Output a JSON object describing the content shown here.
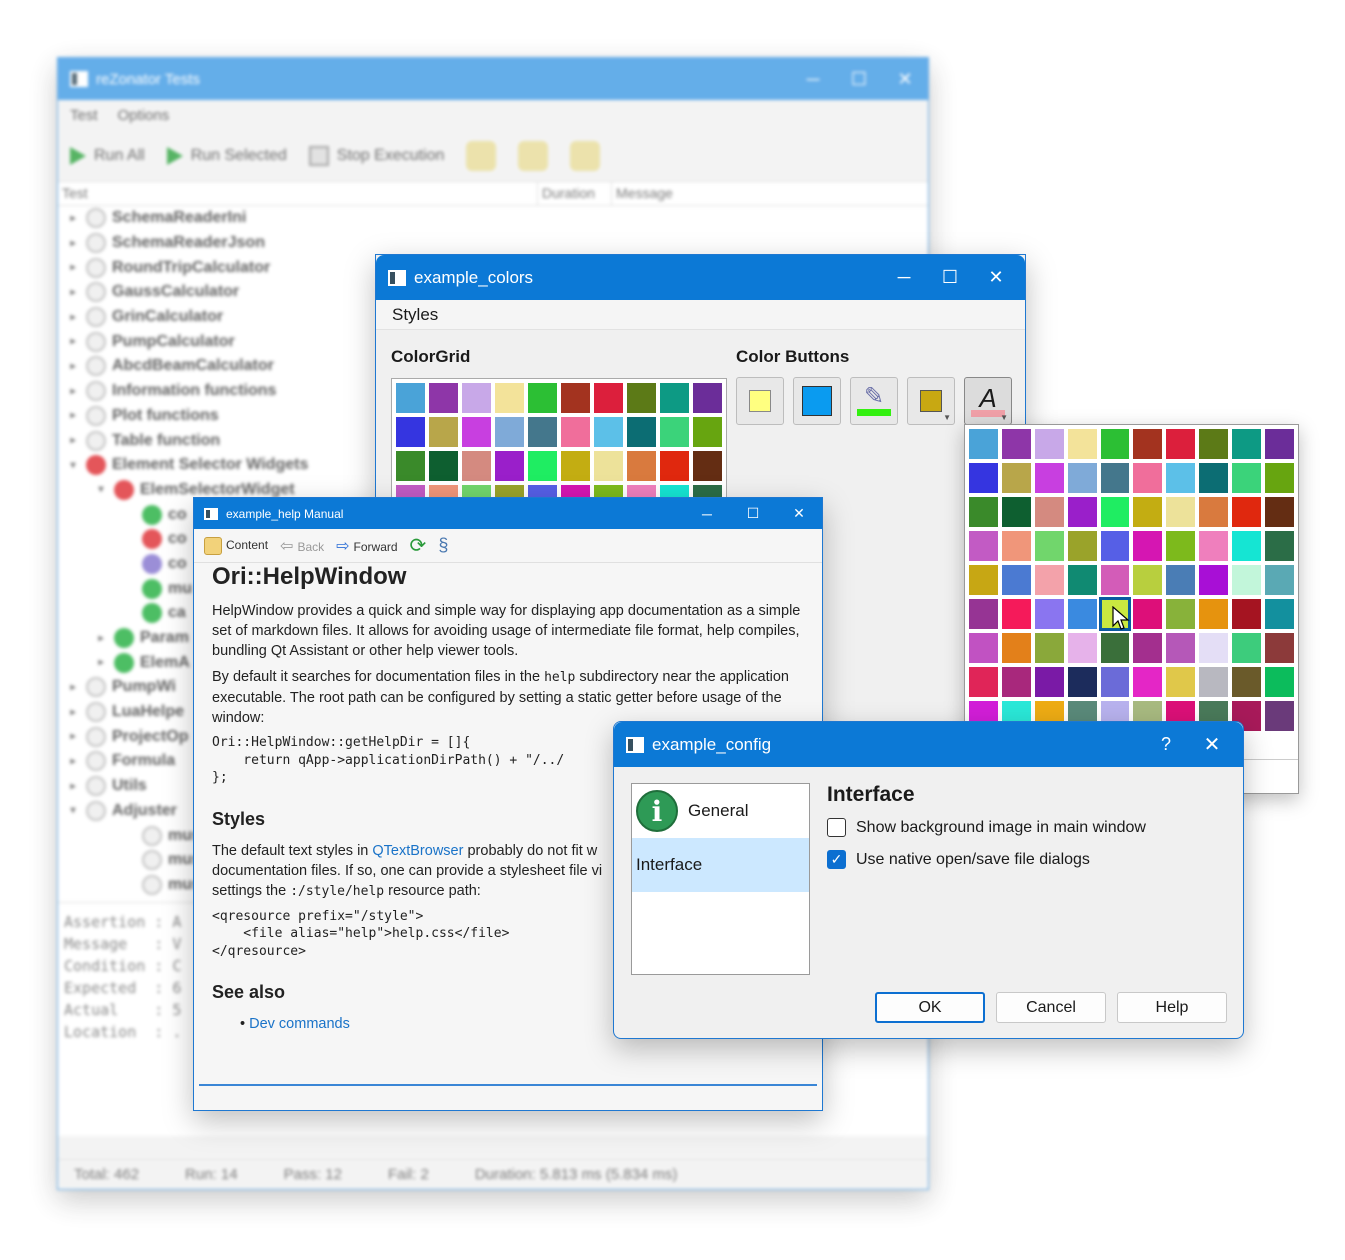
{
  "bg_window": {
    "title": "reZonator Tests",
    "menu": [
      "Test",
      "Options"
    ],
    "toolbar": {
      "run_all": "Run All",
      "run_selected": "Run Selected",
      "stop": "Stop Execution"
    },
    "columns": [
      "Test",
      "Duration",
      "Message"
    ],
    "tree": [
      {
        "label": "SchemaReaderIni",
        "status": "none",
        "level": 0,
        "arrow": "▸"
      },
      {
        "label": "SchemaReaderJson",
        "status": "none",
        "level": 0,
        "arrow": "▸"
      },
      {
        "label": "RoundTripCalculator",
        "status": "none",
        "level": 0,
        "arrow": "▸"
      },
      {
        "label": "GaussCalculator",
        "status": "none",
        "level": 0,
        "arrow": "▸"
      },
      {
        "label": "GrinCalculator",
        "status": "none",
        "level": 0,
        "arrow": "▸"
      },
      {
        "label": "PumpCalculator",
        "status": "none",
        "level": 0,
        "arrow": "▸"
      },
      {
        "label": "AbcdBeamCalculator",
        "status": "none",
        "level": 0,
        "arrow": "▸"
      },
      {
        "label": "Information functions",
        "status": "none",
        "level": 0,
        "arrow": "▸"
      },
      {
        "label": "Plot functions",
        "status": "none",
        "level": 0,
        "arrow": "▸"
      },
      {
        "label": "Table function",
        "status": "none",
        "level": 0,
        "arrow": "▸"
      },
      {
        "label": "Element Selector Widgets",
        "status": "fail",
        "level": 0,
        "arrow": "▾"
      },
      {
        "label": "ElemSelectorWidget",
        "status": "fail",
        "level": 1,
        "arrow": "▾"
      },
      {
        "label": "co",
        "status": "pass",
        "level": 2,
        "arrow": ""
      },
      {
        "label": "co",
        "status": "fail",
        "level": 2,
        "arrow": ""
      },
      {
        "label": "co",
        "status": "skip",
        "level": 2,
        "arrow": ""
      },
      {
        "label": "mu",
        "status": "pass",
        "level": 2,
        "arrow": ""
      },
      {
        "label": "ca",
        "status": "pass",
        "level": 2,
        "arrow": ""
      },
      {
        "label": "Param",
        "status": "pass",
        "level": 1,
        "arrow": "▸"
      },
      {
        "label": "ElemA",
        "status": "pass",
        "level": 1,
        "arrow": "▸"
      },
      {
        "label": "PumpWi",
        "status": "none",
        "level": 0,
        "arrow": "▸"
      },
      {
        "label": "LuaHelpe",
        "status": "none",
        "level": 0,
        "arrow": "▸"
      },
      {
        "label": "ProjectOp",
        "status": "none",
        "level": 0,
        "arrow": "▸"
      },
      {
        "label": "Formula",
        "status": "none",
        "level": 0,
        "arrow": "▸"
      },
      {
        "label": "Utils",
        "status": "none",
        "level": 0,
        "arrow": "▸"
      },
      {
        "label": "Adjuster",
        "status": "none",
        "level": 0,
        "arrow": "▾"
      },
      {
        "label": "must_",
        "status": "none",
        "level": 2,
        "arrow": ""
      },
      {
        "label": "must_",
        "status": "none",
        "level": 2,
        "arrow": ""
      },
      {
        "label": "must_",
        "status": "none",
        "level": 2,
        "arrow": ""
      }
    ],
    "details": [
      "Assertion : A",
      "Message   : V",
      "Condition : C",
      "Expected  : 6",
      "Actual    : 5",
      "Location  : ."
    ],
    "status": {
      "total": "Total: 462",
      "run": "Run: 14",
      "pass": "Pass: 12",
      "fail": "Fail: 2",
      "duration": "Duration: 5.813 ms (5.834 ms)"
    }
  },
  "colors_window": {
    "title": "example_colors",
    "menu": "Styles",
    "grid_title": "ColorGrid",
    "buttons_title": "Color Buttons"
  },
  "palette": [
    "#4aa3d8",
    "#8e36a8",
    "#c8a8e8",
    "#f3e39a",
    "#2cbf34",
    "#a3331f",
    "#dc1f3c",
    "#5c7a17",
    "#0d9a84",
    "#6b2d99",
    "#3535e0",
    "#b8a64a",
    "#c83fe0",
    "#7faad8",
    "#44778c",
    "#f06e9b",
    "#5cc0e8",
    "#0c6d73",
    "#3bd37a",
    "#67a510",
    "#3a8a2a",
    "#0e5f30",
    "#d48a80",
    "#9a1fca",
    "#1fed62",
    "#c3ad12",
    "#ede29a",
    "#d97a3e",
    "#e0280e",
    "#642d13",
    "#c25bc4",
    "#f0967a",
    "#71d66c",
    "#9aa32a",
    "#565fe6",
    "#d516b2",
    "#7dba1c",
    "#ef7fbd",
    "#15e5d3",
    "#2b6d47",
    "#c7a714",
    "#4b7ad2",
    "#f3a2aa",
    "#108a72",
    "#d35cb8",
    "#b8cf3e",
    "#4a7db5",
    "#a80fd6",
    "#c2f6da",
    "#5aa9b4",
    "#963494",
    "#f51a5a",
    "#8a75f0",
    "#3a8ae0",
    "#c9e840",
    "#dd0f79",
    "#88b23a",
    "#e6930e",
    "#a51421",
    "#13909e",
    "#c152c2",
    "#e3801a",
    "#8aa83a",
    "#e6b2ea",
    "#3a6f3a",
    "#a32f8e",
    "#b558b8",
    "#e4def6",
    "#3dcc7c",
    "#8c3a3a",
    "#e02558",
    "#a8287c",
    "#7a1aa6",
    "#1c2c5c",
    "#6b6bd8",
    "#e426c6",
    "#e0c84a",
    "#b8b8c0",
    "#6a5a2a",
    "#0cbc5c",
    "#d21ed8",
    "#2ae8d8",
    "#eeac14",
    "#5a8a7a",
    "#b8b2ee",
    "#a8ba80",
    "#dc1078",
    "#4a7a5a",
    "#a81a5a",
    "#6a3a7a"
  ],
  "help_window": {
    "title": "example_help Manual",
    "toolbar": {
      "content": "Content",
      "back": "Back",
      "forward": "Forward"
    },
    "heading": "Ori::HelpWindow",
    "p1": "HelpWindow provides a quick and simple way for displaying app documentation as a simple set of markdown files. It allows for avoiding usage of intermediate file format, help compiles, bundling Qt Assistant or other help viewer tools.",
    "p2_a": "By default it searches for documentation files in the ",
    "p2_code": "help",
    "p2_b": " subdirectory near the application executable. The root path can be configured by setting a static getter before usage of the window:",
    "code1": "Ori::HelpWindow::getHelpDir = []{\n    return qApp->applicationDirPath() + \"/../\n};",
    "h_styles": "Styles",
    "p3_a": "The default text styles in ",
    "p3_link": "QTextBrowser",
    "p3_b": " probably do not fit w",
    "p3_c": "documentation files. If so, one can provide a stylesheet file vi",
    "p3_d": "settings the ",
    "p3_code": ":/style/help",
    "p3_e": " resource path:",
    "code2": "<qresource prefix=\"/style\">\n    <file alias=\"help\">help.css</file>\n</qresource>",
    "h_seealso": "See also",
    "link_dev": "Dev commands"
  },
  "config_window": {
    "title": "example_config",
    "help_glyph": "?",
    "nav": [
      "General",
      "Interface"
    ],
    "section_title": "Interface",
    "opt1": "Show background image in main window",
    "opt1_checked": false,
    "opt2": "Use native open/save file dialogs",
    "opt2_checked": true,
    "ok": "OK",
    "cancel": "Cancel",
    "help": "Help"
  },
  "icons": {
    "minimize": "─",
    "maximize": "☐",
    "close": "✕",
    "info": "i",
    "pencil": "✎",
    "text": "A",
    "check": "✓"
  }
}
